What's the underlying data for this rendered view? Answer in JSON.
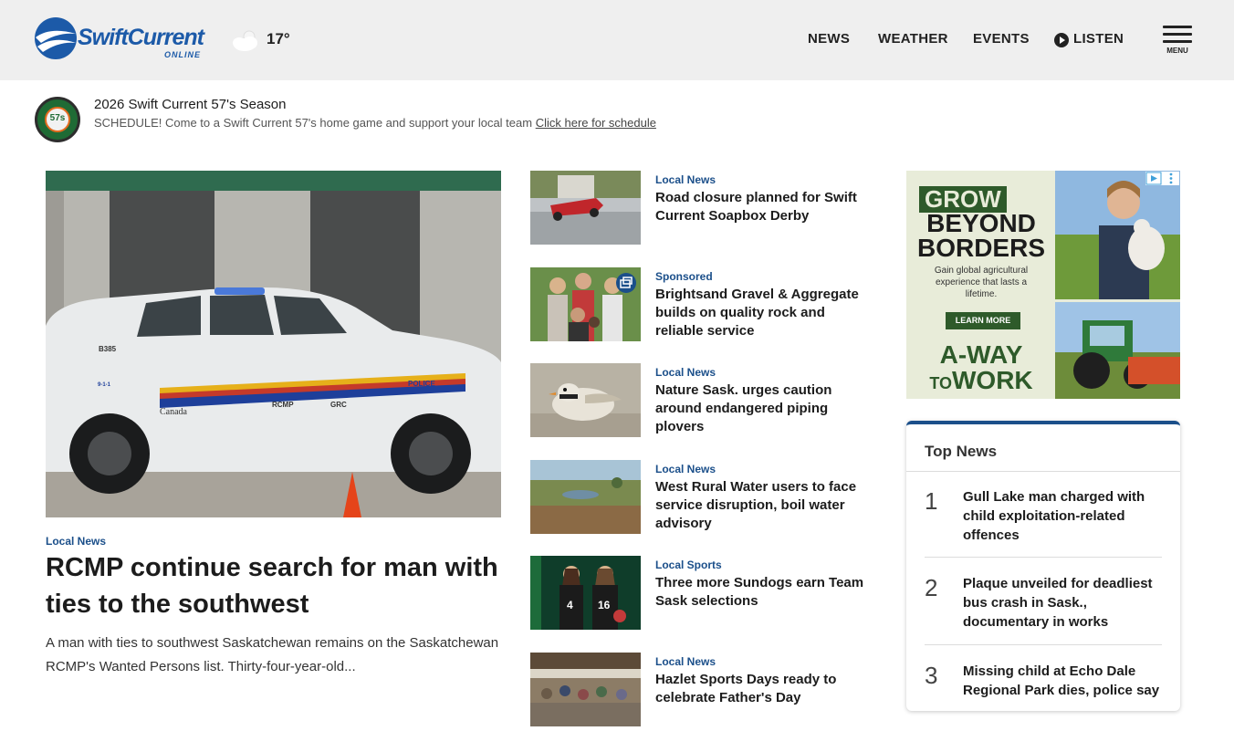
{
  "header": {
    "logo_text": "SwiftCurrent",
    "logo_sub": "ONLINE",
    "weather_icon": "partly-cloudy-icon",
    "temperature": "17°",
    "nav": [
      "NEWS",
      "WEATHER",
      "EVENTS",
      "LISTEN"
    ],
    "menu_label": "MENU"
  },
  "promo": {
    "logo_text": "57s",
    "title": "2026 Swift Current 57's Season",
    "description": "SCHEDULE! Come to a Swift Current 57's home game and support your local team ",
    "link": "Click here for schedule"
  },
  "hero": {
    "category": "Local News",
    "title": "RCMP continue search for man with ties to the southwest",
    "excerpt": "A man with ties to southwest Saskatchewan remains on the Saskatchewan RCMP's Wanted Persons list. Thirty-four-year-old...",
    "image_text": {
      "police": "POLICE",
      "rcmp": "RCMP",
      "grc": "GRC",
      "canada": "Canada",
      "unit": "B385",
      "phone": "9-1-1"
    }
  },
  "stories": [
    {
      "category": "Local News",
      "title": "Road closure planned for Swift Current Soapbox Derby"
    },
    {
      "category": "Sponsored",
      "title": "Brightsand Gravel & Aggregate builds on quality rock and reliable service"
    },
    {
      "category": "Local News",
      "title": "Nature Sask. urges caution around endangered piping plovers"
    },
    {
      "category": "Local News",
      "title": "West Rural Water users to face service disruption, boil water advisory"
    },
    {
      "category": "Local Sports",
      "title": "Three more Sundogs earn Team Sask selections"
    },
    {
      "category": "Local News",
      "title": "Hazlet Sports Days ready to celebrate Father's Day"
    }
  ],
  "ad": {
    "grow": "GROW",
    "beyond": "BEYOND",
    "borders": "BORDERS",
    "gain": "Gain global agricultural experience that lasts a lifetime.",
    "learn_more": "LEARN MORE",
    "away": "A-WAY",
    "to": "TO",
    "work": "WORK"
  },
  "top_news": {
    "title": "Top News",
    "items": [
      {
        "rank": "1",
        "title": "Gull Lake man charged with child exploitation-related offences"
      },
      {
        "rank": "2",
        "title": "Plaque unveiled for deadliest bus crash in Sask., documentary in works"
      },
      {
        "rank": "3",
        "title": "Missing child at Echo Dale Regional Park dies, police say"
      }
    ]
  },
  "colors": {
    "brand_blue": "#1c5aa8",
    "category_blue": "#1b4f8a",
    "header_bg": "#efefef",
    "ad_green": "#2e5a2a"
  }
}
